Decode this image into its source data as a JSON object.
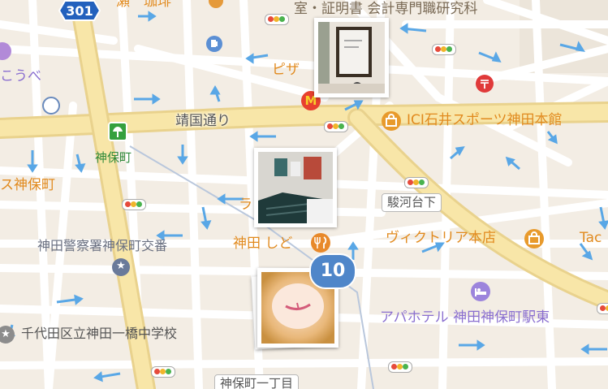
{
  "map": {
    "route_shield": "301",
    "streets": {
      "yasukuni_dori": "靖国通り",
      "surugadai_shita": "駿河台下",
      "jimbocho_1chome": "神保町一丁目"
    },
    "pois": {
      "top_left_partial": "瀬　珈琲",
      "certification_school": "室・証明書 会計専門職研究科",
      "pizza_partial": "ピザ",
      "kotobe_partial": "こうべ",
      "ici_ishii": "ICI石井スポーツ神田本館",
      "jimbocho_partial_left": "ス神保町",
      "police_box": "神田警察署神保町交番",
      "kanda_shido": "神田 しど",
      "victoria": "ヴィクトリア本店",
      "taco_partial": "Tac",
      "apa_hotel": "アパホテル 神田神保町駅東",
      "school": "千代田区立神田一橋中学校",
      "la_partial": "ラ"
    },
    "station": "神保町",
    "cluster_count": "10",
    "icons": [
      "subway-station-icon",
      "gas-station-icon",
      "post-office-icon",
      "mcdonalds-icon",
      "shopping-bag-icon",
      "restaurant-icon",
      "hotel-icon",
      "police-icon",
      "school-icon",
      "traffic-light-icon",
      "photo-thumbnail"
    ],
    "colors": {
      "background": "#f3ede4",
      "major_road": "#f7e3a3",
      "minor_road": "#ffffff",
      "one_way_arrow": "#59a7e6",
      "poi_orange": "#e18a1e",
      "poi_purple": "#8a6fd0",
      "station_green": "#2f8a3a",
      "cluster_blue": "#4f86c9",
      "route_shield_blue": "#2361bd"
    }
  }
}
